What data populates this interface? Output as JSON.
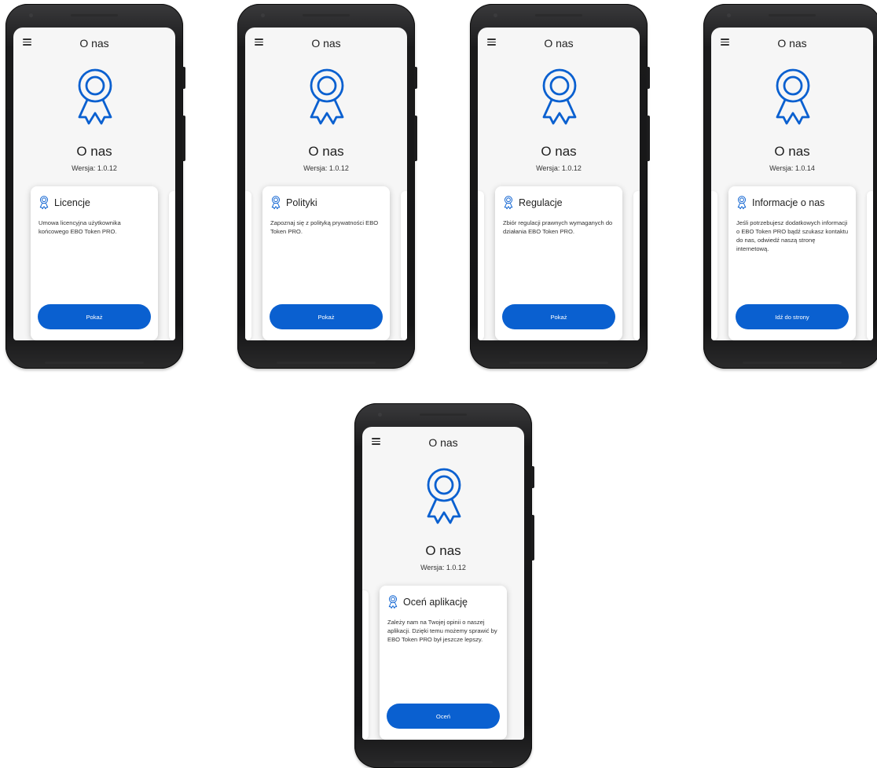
{
  "accent_color": "#0a60d0",
  "screens": [
    {
      "header_title": "O nas",
      "page_title": "O nas",
      "version": "Wersja: 1.0.12",
      "card": {
        "icon": "award-ribbon-icon",
        "title": "Licencje",
        "description": "Umowa licencyjna użytkownika końcowego EBO Token PRO.",
        "button_label": "Pokaż"
      }
    },
    {
      "header_title": "O nas",
      "page_title": "O nas",
      "version": "Wersja: 1.0.12",
      "card": {
        "icon": "award-ribbon-icon",
        "title": "Polityki",
        "description": "Zapoznaj się z polityką prywatności EBO Token PRO.",
        "button_label": "Pokaż"
      }
    },
    {
      "header_title": "O nas",
      "page_title": "O nas",
      "version": "Wersja: 1.0.12",
      "card": {
        "icon": "award-ribbon-icon",
        "title": "Regulacje",
        "description": "Zbiór regulacji prawnych wymaganych do działania EBO Token PRO.",
        "button_label": "Pokaż"
      }
    },
    {
      "header_title": "O nas",
      "page_title": "O nas",
      "version": "Wersja: 1.0.14",
      "card": {
        "icon": "award-ribbon-icon",
        "title": "Informacje o nas",
        "description": "Jeśli potrzebujesz dodatkowych informacji o EBO Token PRO bądź szukasz kontaktu do nas, odwiedź naszą stronę internetową.",
        "button_label": "Idź do strony"
      }
    },
    {
      "header_title": "O nas",
      "page_title": "O nas",
      "version": "Wersja: 1.0.12",
      "card": {
        "icon": "award-ribbon-icon",
        "title": "Oceń aplikację",
        "description": "Zależy nam na Twojej opinii o naszej aplikacji. Dzięki temu możemy sprawić by EBO Token PRO był jeszcze lepszy.",
        "button_label": "Oceń"
      }
    }
  ]
}
